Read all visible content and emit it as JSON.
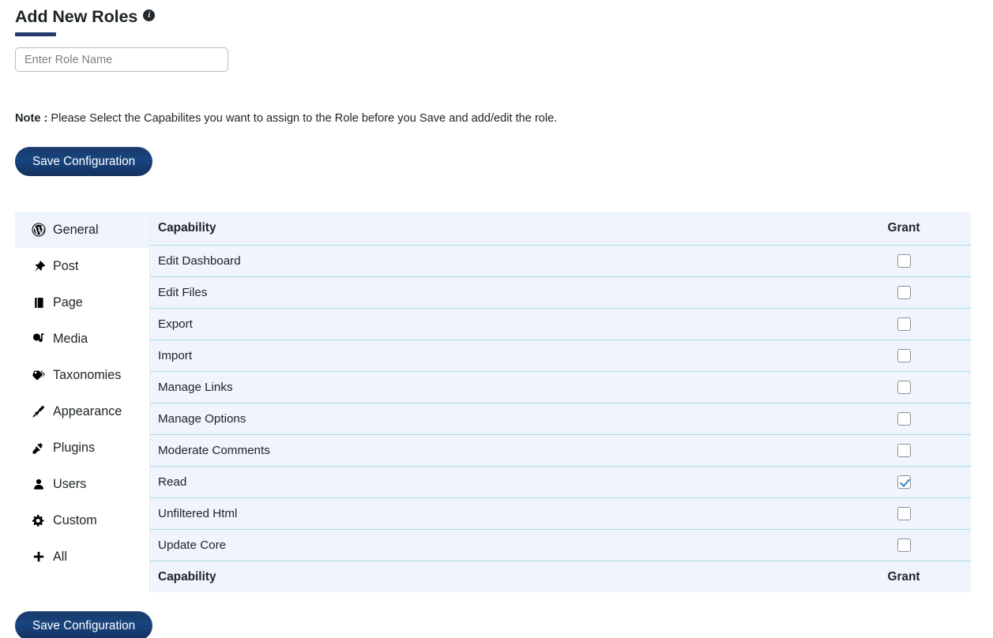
{
  "header": {
    "title": "Add New Roles",
    "info_icon": "info-icon",
    "info_glyph": "i"
  },
  "role_input": {
    "placeholder": "Enter Role Name",
    "value": ""
  },
  "note": {
    "label": "Note :",
    "text": " Please Select the Capabilites you want to assign to the Role before you Save and add/edit the role."
  },
  "buttons": {
    "save_top": "Save Configuration",
    "save_bottom": "Save Configuration"
  },
  "sidebar": {
    "items": [
      {
        "label": "General",
        "icon": "wordpress-icon",
        "active": true
      },
      {
        "label": "Post",
        "icon": "pin-icon",
        "active": false
      },
      {
        "label": "Page",
        "icon": "page-icon",
        "active": false
      },
      {
        "label": "Media",
        "icon": "media-icon",
        "active": false
      },
      {
        "label": "Taxonomies",
        "icon": "tag-icon",
        "active": false
      },
      {
        "label": "Appearance",
        "icon": "paintbrush-icon",
        "active": false
      },
      {
        "label": "Plugins",
        "icon": "plug-icon",
        "active": false
      },
      {
        "label": "Users",
        "icon": "user-icon",
        "active": false
      },
      {
        "label": "Custom",
        "icon": "gear-icon",
        "active": false
      },
      {
        "label": "All",
        "icon": "plus-icon",
        "active": false
      }
    ]
  },
  "table": {
    "columns": [
      "Capability",
      "Grant"
    ],
    "footer_columns": [
      "Capability",
      "Grant"
    ],
    "rows": [
      {
        "capability": "Edit Dashboard",
        "granted": false
      },
      {
        "capability": "Edit Files",
        "granted": false
      },
      {
        "capability": "Export",
        "granted": false
      },
      {
        "capability": "Import",
        "granted": false
      },
      {
        "capability": "Manage Links",
        "granted": false
      },
      {
        "capability": "Manage Options",
        "granted": false
      },
      {
        "capability": "Moderate Comments",
        "granted": false
      },
      {
        "capability": "Read",
        "granted": true
      },
      {
        "capability": "Unfiltered Html",
        "granted": false
      },
      {
        "capability": "Update Core",
        "granted": false
      }
    ]
  },
  "colors": {
    "accent_navy": "#243a6b",
    "button_gradient_start": "#1b3a6b",
    "button_gradient_end": "#14315e",
    "table_bg": "#eff4fd",
    "row_divider": "#a9dce3",
    "active_item_bg": "#eff4fd",
    "checkbox_check": "#3582c4",
    "info_icon_bg": "#23282d"
  }
}
